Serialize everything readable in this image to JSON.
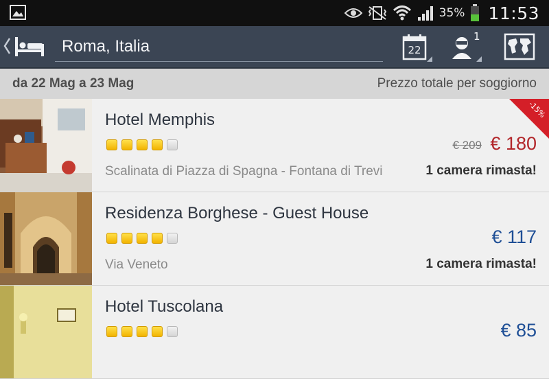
{
  "status_bar": {
    "battery_percent": "35%",
    "time": "11:53",
    "icons": [
      "image-icon",
      "eye-icon",
      "vibrate-silent-icon",
      "wifi-icon",
      "signal-icon",
      "battery-icon"
    ]
  },
  "action_bar": {
    "location": "Roma, Italia",
    "calendar_day": "22",
    "guest_count": "1",
    "icons": [
      "back-chevron-icon",
      "bed-icon",
      "calendar-icon",
      "guest-icon",
      "map-icon"
    ]
  },
  "date_bar": {
    "dates": "da 22 Mag a 23 Mag",
    "price_note": "Prezzo totale per soggiorno"
  },
  "colors": {
    "action_bar_bg": "#3b4554",
    "discount_red": "#b2262a",
    "price_blue": "#1f4f96",
    "star_gold": "#f2b300"
  },
  "hotels": [
    {
      "name": "Hotel Memphis",
      "stars": 4,
      "max_stars": 5,
      "old_price": "€ 209",
      "price": "€ 180",
      "address": "Scalinata di Piazza di Spagna - Fontana di Trevi",
      "availability": "1 camera rimasta!",
      "discount": "-15%"
    },
    {
      "name": "Residenza Borghese - Guest House",
      "stars": 4,
      "max_stars": 5,
      "price": "€ 117",
      "address": "Via Veneto",
      "availability": "1 camera rimasta!"
    },
    {
      "name": "Hotel Tuscolana",
      "stars": 4,
      "max_stars": 5,
      "price": "€ 85",
      "address": "",
      "availability": ""
    }
  ]
}
